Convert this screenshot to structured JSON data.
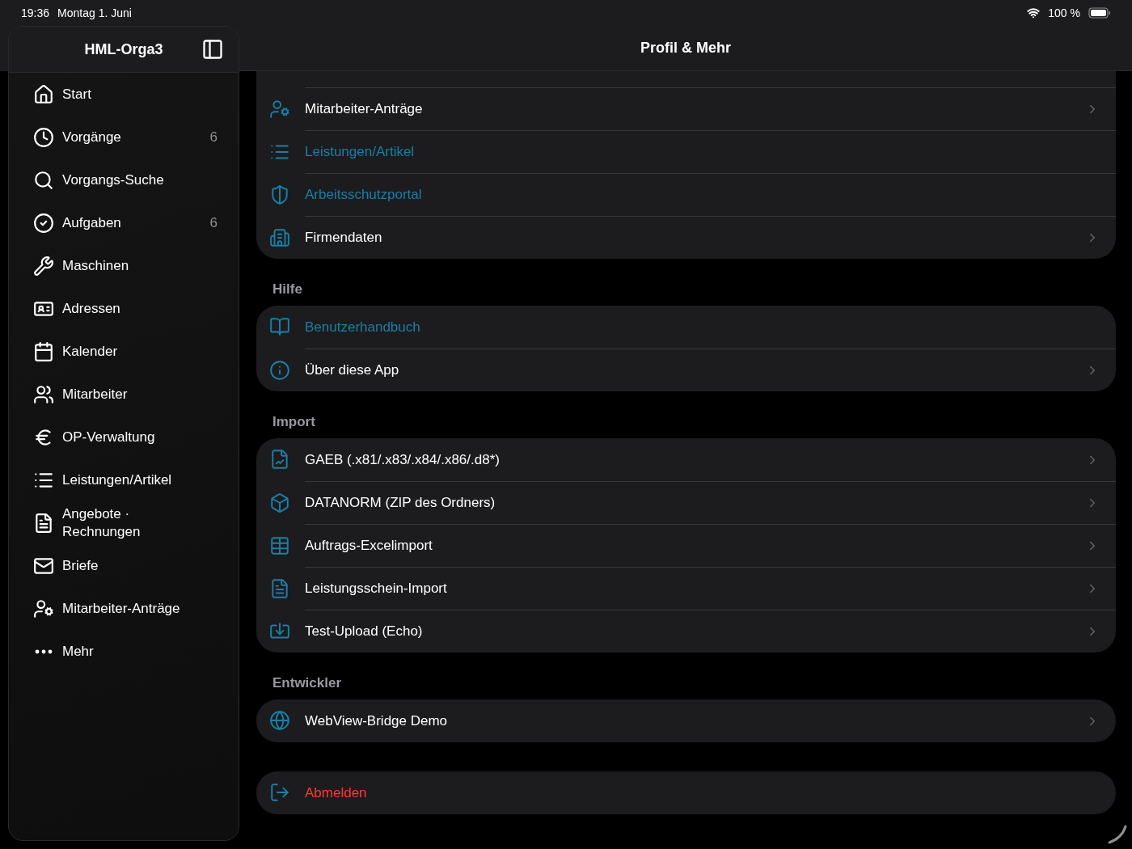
{
  "status_bar": {
    "time": "19:36",
    "date": "Montag 1. Juni",
    "battery": "100 %"
  },
  "sidebar": {
    "title": "HML-Orga3",
    "items": [
      {
        "label": "Start"
      },
      {
        "label": "Vorgänge",
        "badge": "6"
      },
      {
        "label": "Vorgangs-Suche"
      },
      {
        "label": "Aufgaben",
        "badge": "6"
      },
      {
        "label": "Maschinen"
      },
      {
        "label": "Adressen"
      },
      {
        "label": "Kalender"
      },
      {
        "label": "Mitarbeiter"
      },
      {
        "label": "OP-Verwaltung"
      },
      {
        "label": "Leistungen/Artikel"
      },
      {
        "label": "Angebote ·\nRechnungen"
      },
      {
        "label": "Briefe"
      },
      {
        "label": "Mitarbeiter-Anträge"
      },
      {
        "label": "Mehr"
      }
    ]
  },
  "main": {
    "title": "Profil & Mehr",
    "sections": [
      {
        "rows": [
          {
            "label": "Mitarbeiter-Anträge",
            "kind": "nav"
          },
          {
            "label": "Leistungen/Artikel",
            "kind": "link"
          },
          {
            "label": "Arbeitsschutzportal",
            "kind": "link"
          },
          {
            "label": "Firmendaten",
            "kind": "nav"
          }
        ]
      },
      {
        "header": "Hilfe",
        "rows": [
          {
            "label": "Benutzerhandbuch",
            "kind": "link"
          },
          {
            "label": "Über diese App",
            "kind": "nav"
          }
        ]
      },
      {
        "header": "Import",
        "rows": [
          {
            "label": "GAEB (.x81/.x83/.x84/.x86/.d8*)",
            "kind": "nav"
          },
          {
            "label": "DATANORM (ZIP des Ordners)",
            "kind": "nav"
          },
          {
            "label": "Auftrags-Excelimport",
            "kind": "nav"
          },
          {
            "label": "Leistungsschein-Import",
            "kind": "nav"
          },
          {
            "label": "Test-Upload (Echo)",
            "kind": "nav"
          }
        ]
      },
      {
        "header": "Entwickler",
        "rows": [
          {
            "label": "WebView-Bridge Demo",
            "kind": "nav"
          }
        ]
      },
      {
        "rows": [
          {
            "label": "Abmelden",
            "kind": "danger"
          }
        ]
      }
    ]
  }
}
